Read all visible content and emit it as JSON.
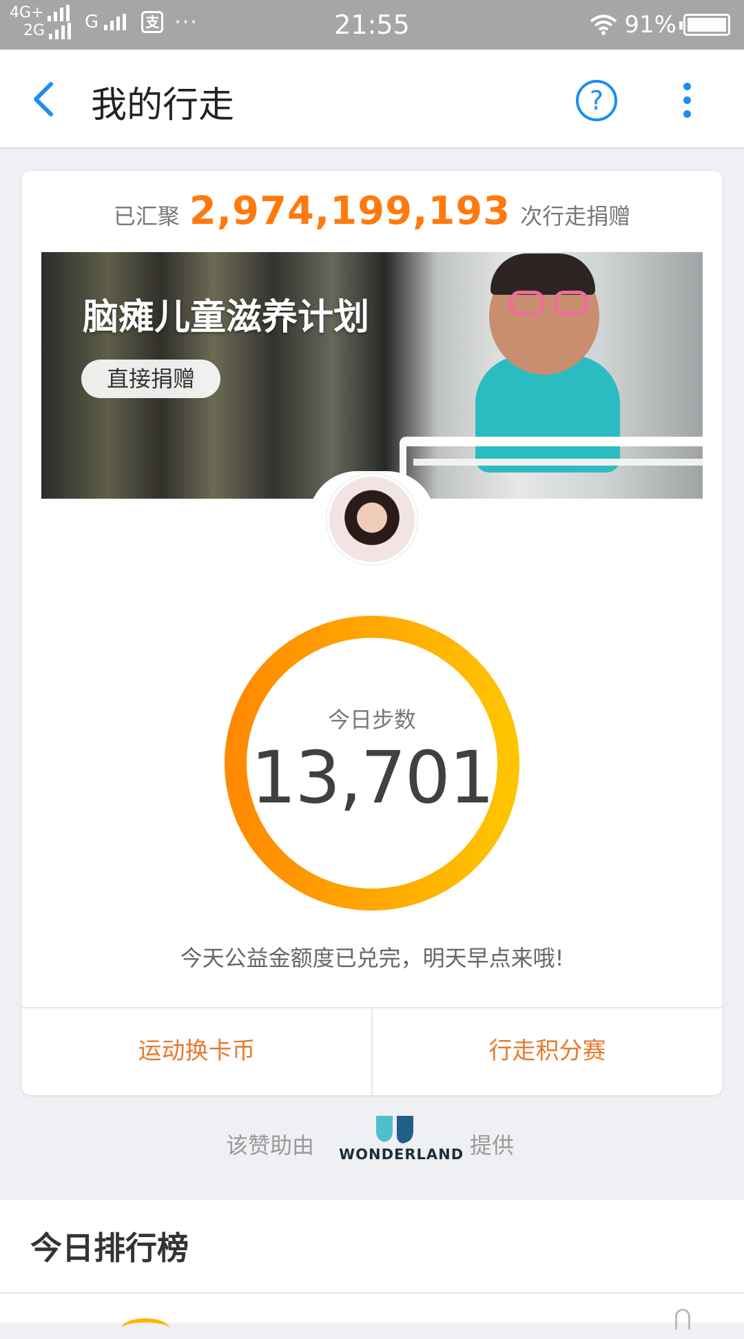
{
  "status_bar": {
    "network_top": "4G+",
    "network_bottom": "2G",
    "carrier2": "G",
    "more": "···",
    "time": "21:55",
    "battery": "91%"
  },
  "app_bar": {
    "title": "我的行走",
    "back_icon": "chevron-left-icon",
    "help_icon": "question-circle-icon",
    "help_glyph": "?",
    "more_icon": "vertical-dots-icon"
  },
  "summary": {
    "prefix": "已汇聚",
    "total": "2,974,199,193",
    "suffix": "次行走捐赠"
  },
  "banner": {
    "title": "脑瘫儿童滋养计划",
    "donate_label": "直接捐赠"
  },
  "steps": {
    "label": "今日步数",
    "value": "13,701",
    "ring_colors": [
      "#ff8a00",
      "#ffc400"
    ]
  },
  "quota_note": "今天公益金额度已兑完，明天早点来哦!",
  "actions": [
    {
      "label": "运动换卡币"
    },
    {
      "label": "行走积分赛"
    }
  ],
  "sponsor": {
    "prefix": "该赞助由",
    "brand": "WONDERLAND",
    "suffix": "提供"
  },
  "ranking": {
    "title": "今日排行榜"
  },
  "colors": {
    "accent_blue": "#1b8ef0",
    "accent_orange": "#ff7a0e",
    "action_orange": "#e77a2c"
  }
}
